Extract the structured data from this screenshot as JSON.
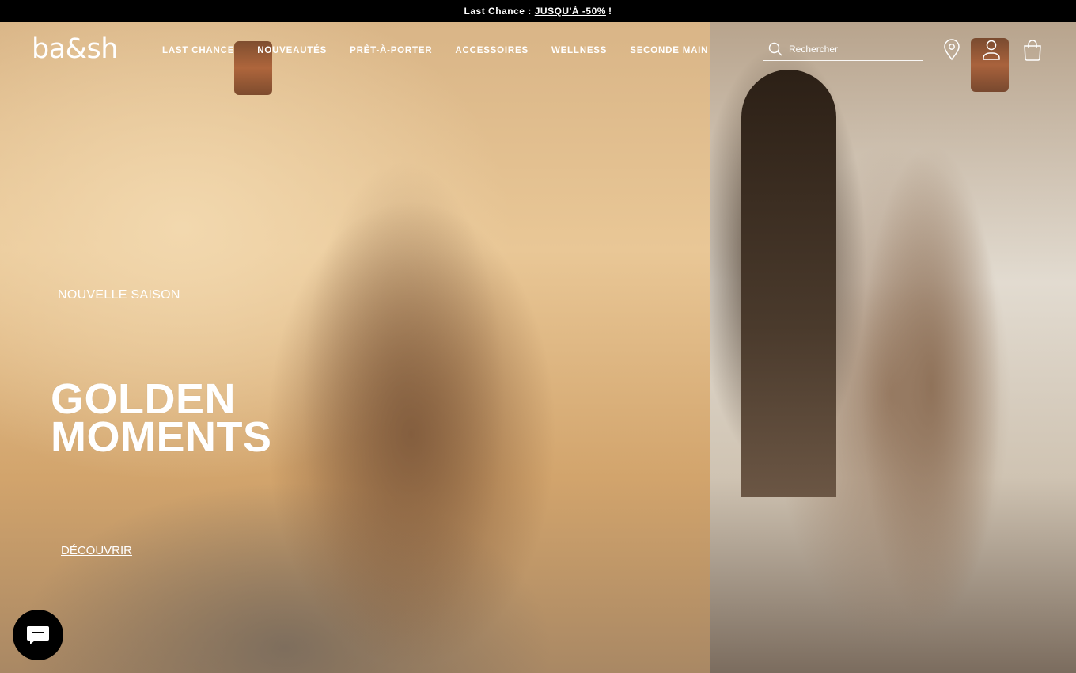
{
  "promo": {
    "prefix": "Last Chance :",
    "link": "JUSQU'À -50%",
    "suffix": "!"
  },
  "header": {
    "logo": "ba&sh",
    "nav": [
      {
        "label": "LAST CHANCE"
      },
      {
        "label": "NOUVEAUTÉS"
      },
      {
        "label": "PRÊT-À-PORTER"
      },
      {
        "label": "ACCESSOIRES"
      },
      {
        "label": "WELLNESS"
      },
      {
        "label": "SECONDE MAIN"
      }
    ],
    "search": {
      "placeholder": "Rechercher"
    },
    "icons": [
      "store-locator-icon",
      "account-icon",
      "cart-icon"
    ]
  },
  "hero": {
    "eyebrow": "NOUVELLE SAISON",
    "headline_line1": "GOLDEN",
    "headline_line2": "MOMENTS",
    "cta": "DÉCOUVRIR"
  },
  "chat": {
    "icon": "chat-icon"
  },
  "colors": {
    "promo_bg": "#000000",
    "text": "#ffffff",
    "chat_bg": "#000000"
  }
}
